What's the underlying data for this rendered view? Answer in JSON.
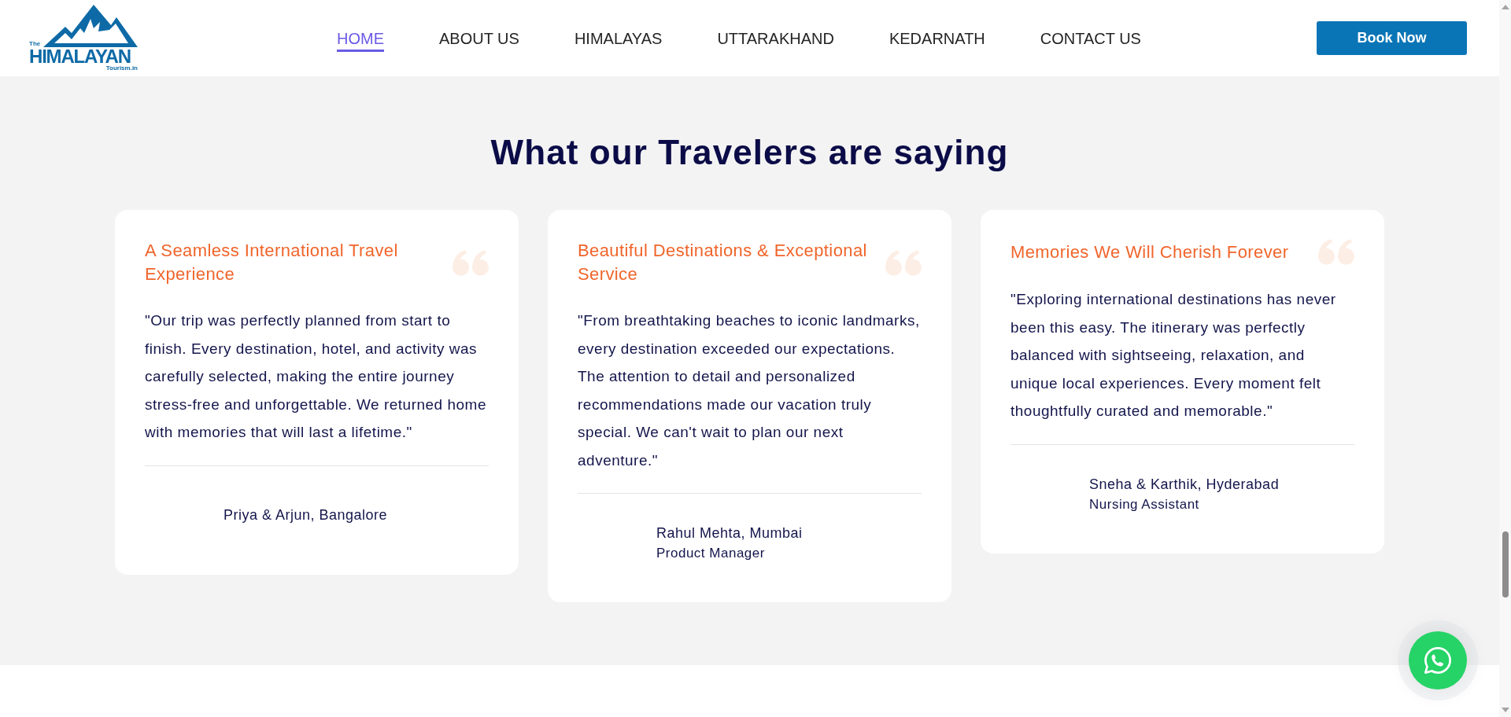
{
  "header": {
    "logo": {
      "prefix": "The",
      "name": "HIMALAYAN",
      "suffix": "Tourism.in"
    },
    "nav": [
      {
        "label": "HOME",
        "selected": true
      },
      {
        "label": "ABOUT US",
        "selected": false
      },
      {
        "label": "HIMALAYAS",
        "selected": false
      },
      {
        "label": "UTTARAKHAND",
        "selected": false
      },
      {
        "label": "KEDARNATH",
        "selected": false
      },
      {
        "label": "CONTACT US",
        "selected": false
      }
    ],
    "cta": "Book Now"
  },
  "testimonials": {
    "title": "What our Travelers are saying",
    "cards": [
      {
        "title": "A Seamless International Travel Experience",
        "quote": "\"Our trip was perfectly planned from start to finish. Every destination, hotel, and activity was carefully selected, making the entire journey stress-free and unforgettable. We returned home with memories that will last a lifetime.\"",
        "author": "Priya & Arjun, Bangalore"
      },
      {
        "title": "Beautiful Destinations & Exceptional Service",
        "quote": "\"From breathtaking beaches to iconic landmarks, every destination exceeded our expectations. The attention to detail and personalized recommendations made our vacation truly special. We can't wait to plan our next adventure.\"",
        "author": "Rahul Mehta, Mumbai",
        "role": "Product Manager"
      },
      {
        "title": "Memories We Will Cherish Forever",
        "quote": "\"Exploring international destinations has never been this easy. The itinerary was perfectly balanced with sightseeing, relaxation, and unique local experiences. Every moment felt thoughtfully curated and memorable.\"",
        "author": "Sneha & Karthik, Hyderabad",
        "role": "Nursing Assistant"
      }
    ]
  }
}
